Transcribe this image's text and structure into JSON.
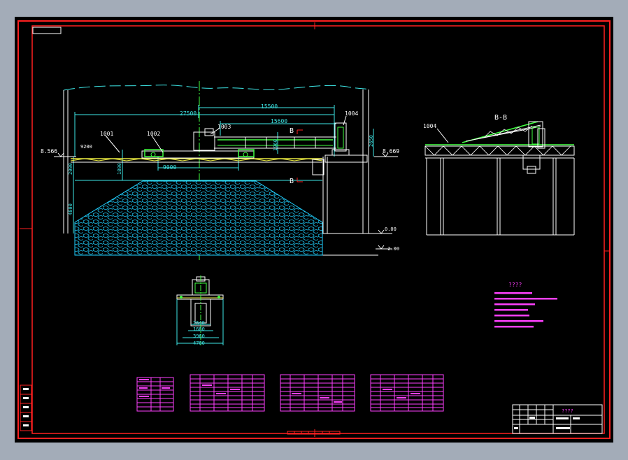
{
  "colors": {
    "background": "#000000",
    "frame": "#ff2020",
    "lines": "#ffffff",
    "dimension": "#3ee8e8",
    "text_magenta": "#ff40ff",
    "machine_green": "#40ff40",
    "ground_cyan": "#20d0ff",
    "yellow": "#e8e840"
  },
  "elevations": {
    "left": "8.566",
    "right": "8.669",
    "ground": "0.00",
    "pit": "-2.00"
  },
  "dimensions": {
    "d27500": "27500",
    "d15500": "15500",
    "d15600": "15600",
    "d9000": "9000",
    "d9200": "9200",
    "d2650": "2650",
    "d1960": "1960",
    "d2000": "2000",
    "d1800": "1800",
    "d4800": "4800",
    "d2640": "2640",
    "d1680": "1680",
    "d3960": "3960",
    "d4700": "4700"
  },
  "part_callouts": {
    "p1001": "1001",
    "p1002": "1002",
    "p1003": "1003",
    "p1004": "1004",
    "p1004b": "1004"
  },
  "section_marks": {
    "b_top": "B",
    "b_bottom": "B",
    "view_title": "B-B"
  },
  "notes": {
    "title": "????"
  },
  "title_block": {
    "name": "????"
  }
}
